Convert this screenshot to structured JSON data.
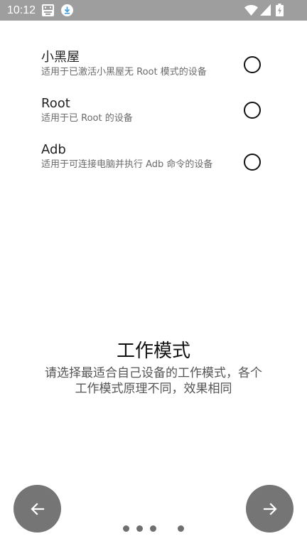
{
  "status_bar": {
    "time": "10:12",
    "icons": [
      "app-notification-icon",
      "download-icon",
      "wifi-icon",
      "cell-signal-icon",
      "battery-charging-icon"
    ]
  },
  "options": [
    {
      "title": "小黑屋",
      "description": "适用于已激活小黑屋无 Root 模式的设备",
      "selected": false
    },
    {
      "title": "Root",
      "description": "适用于已 Root 的设备",
      "selected": false
    },
    {
      "title": "Adb",
      "description": "适用于可连接电脑并执行 Adb 命令的设备",
      "selected": false
    }
  ],
  "mode": {
    "title": "工作模式",
    "description": "请选择最适合自己设备的工作模式，各个工作模式原理不同，效果相同"
  },
  "navigation": {
    "back_icon": "arrow-left-icon",
    "next_icon": "arrow-right-icon"
  },
  "page_indicator": {
    "total": 4,
    "current": 3
  },
  "colors": {
    "status_bar": "#9e9e9e",
    "nav_button": "#757575",
    "dot": "#6f6f6f"
  }
}
